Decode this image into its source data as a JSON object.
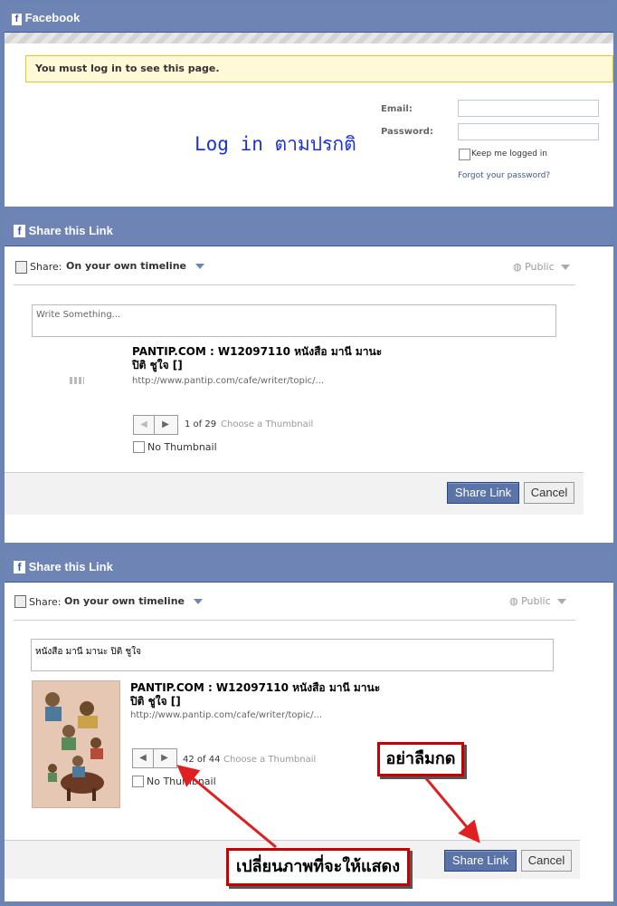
{
  "login": {
    "header_title": "Facebook",
    "warning": "You must log in to see this page.",
    "handwritten_note": "Log in ตามปรกติ",
    "email_label": "Email:",
    "password_label": "Password:",
    "keep_logged": "Keep me logged in",
    "forgot": "Forgot your password?"
  },
  "share1": {
    "header_title": "Share this Link",
    "share_label": "Share:",
    "target": "On your own timeline",
    "privacy": "Public",
    "placeholder": "Write Something...",
    "link_title": "PANTIP.COM : W12097110 หนังสือ มานี มานะ ปิติ ชูใจ []",
    "link_url": "http://www.pantip.com/cafe/writer/topic/...",
    "page_count": "1 of 29",
    "choose_thumb": "Choose a Thumbnail",
    "no_thumb": "No Thumbnail",
    "share_btn": "Share Link",
    "cancel_btn": "Cancel"
  },
  "share2": {
    "header_title": "Share this Link",
    "share_label": "Share:",
    "target": "On your own timeline",
    "privacy": "Public",
    "message": "หนังสือ มานี มานะ ปิติ ชูใจ",
    "link_title": "PANTIP.COM : W12097110 หนังสือ มานี มานะ ปิติ ชูใจ []",
    "link_url": "http://www.pantip.com/cafe/writer/topic/...",
    "page_count": "42 of 44",
    "choose_thumb": "Choose a Thumbnail",
    "no_thumb": "No Thumbnail",
    "share_btn": "Share Link",
    "cancel_btn": "Cancel"
  },
  "annotations": {
    "dont_forget": "อย่าลืมกด",
    "change_image": "เปลี่ยนภาพที่จะให้แสดง"
  },
  "colors": {
    "fb_blue": "#6d84b4",
    "callout_red": "#c80000"
  }
}
